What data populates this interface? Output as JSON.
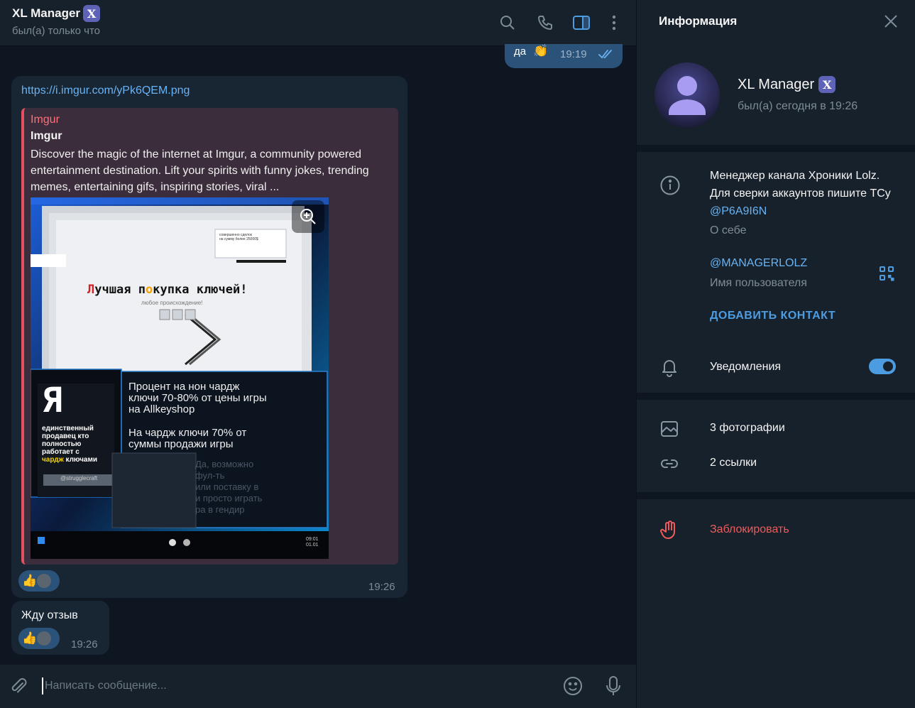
{
  "header": {
    "title": "XL Manager",
    "badge": "X",
    "status": "был(а) только что"
  },
  "messages": {
    "outgoing": {
      "text": "да",
      "emoji": "👏",
      "time": "19:19"
    },
    "incoming1": {
      "link": "https://i.imgur.com/yPk6QEM.png",
      "preview": {
        "site": "Imgur",
        "title": "Imgur",
        "description": "Discover the magic of the internet at Imgur, a community powered entertainment destination. Lift your spirits with funny jokes, trending memes, entertaining gifs, inspiring stories, viral ...",
        "image": {
          "headline": "Лучшая покупка ключей!",
          "headline_sub": "любое происхождение!",
          "corner_note_1": "совершенно сделок",
          "corner_note_2": "на сумму более 25000$",
          "logo_letter": "Я",
          "left_caption_1": "единственный",
          "left_caption_2": "продавец кто",
          "left_caption_3": "полностью",
          "left_caption_4": "работает с",
          "left_caption_5a": "чардж",
          "left_caption_5b": " ключами",
          "handle": "@strugglecraft",
          "right_line_1": "Процент на нон чардж",
          "right_line_2": "ключи 70-80% от цены игры",
          "right_line_3": "на Allkeyshop",
          "right_line_4": "На чардж ключи 70% от",
          "right_line_5": "суммы продажи игры",
          "faded_1": "Да, возможно",
          "faded_2": "фул-ть",
          "faded_3": "или поставку в",
          "faded_4": "и просто играть",
          "faded_5": "ра в гендир",
          "clock_1": "09:01",
          "clock_2": "01.01"
        }
      },
      "reaction": "👍",
      "time": "19:26"
    },
    "incoming2": {
      "text": "Жду отзыв",
      "reaction": "👍",
      "time": "19:26"
    }
  },
  "composer": {
    "placeholder": "Написать сообщение..."
  },
  "panel": {
    "title": "Информация",
    "name": "XL Manager",
    "badge": "X",
    "seen": "был(а) сегодня в 19:26",
    "bio_text": "Менеджер канала Хроники Lolz. Для сверки аккаунтов пишите ТСу ",
    "bio_mention": "@P6A9I6N",
    "bio_label": "О себе",
    "username": "@MANAGERLOLZ",
    "username_label": "Имя пользователя",
    "add_contact": "ДОБАВИТЬ КОНТАКТ",
    "notifications": "Уведомления",
    "notifications_on": true,
    "photos": "3 фотографии",
    "links": "2 ссылки",
    "block": "Заблокировать"
  },
  "colors": {
    "accent": "#4c9ce2",
    "link": "#6ab3f3",
    "danger": "#ef5b5b",
    "outgoing_bubble": "#2b5278",
    "incoming_bubble": "#182533"
  }
}
